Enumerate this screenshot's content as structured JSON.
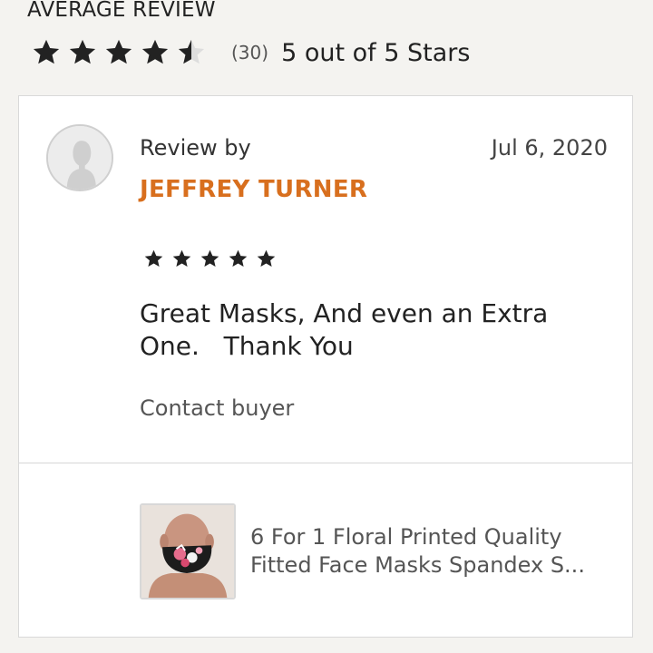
{
  "header": {
    "title": "AVERAGE REVIEW",
    "rating_stars": 4.5,
    "review_count": "(30)",
    "stars_text": "5 out of 5 Stars"
  },
  "review": {
    "review_by_label": "Review by",
    "reviewer_name": "JEFFREY TURNER",
    "date": "Jul 6, 2020",
    "rating_stars": 5,
    "text": "Great Masks, And even an Extra\nOne.   Thank You",
    "contact_label": "Contact buyer"
  },
  "product": {
    "title_line1": "6 For 1 Floral Printed Quality",
    "title_line2": "Fitted Face Masks Spandex S..."
  },
  "icons": {
    "star": "star-icon",
    "half_star": "half-star-icon",
    "avatar": "user-avatar-icon"
  },
  "colors": {
    "accent": "#d86f1e",
    "background": "#f4f3f0",
    "card": "#ffffff"
  }
}
